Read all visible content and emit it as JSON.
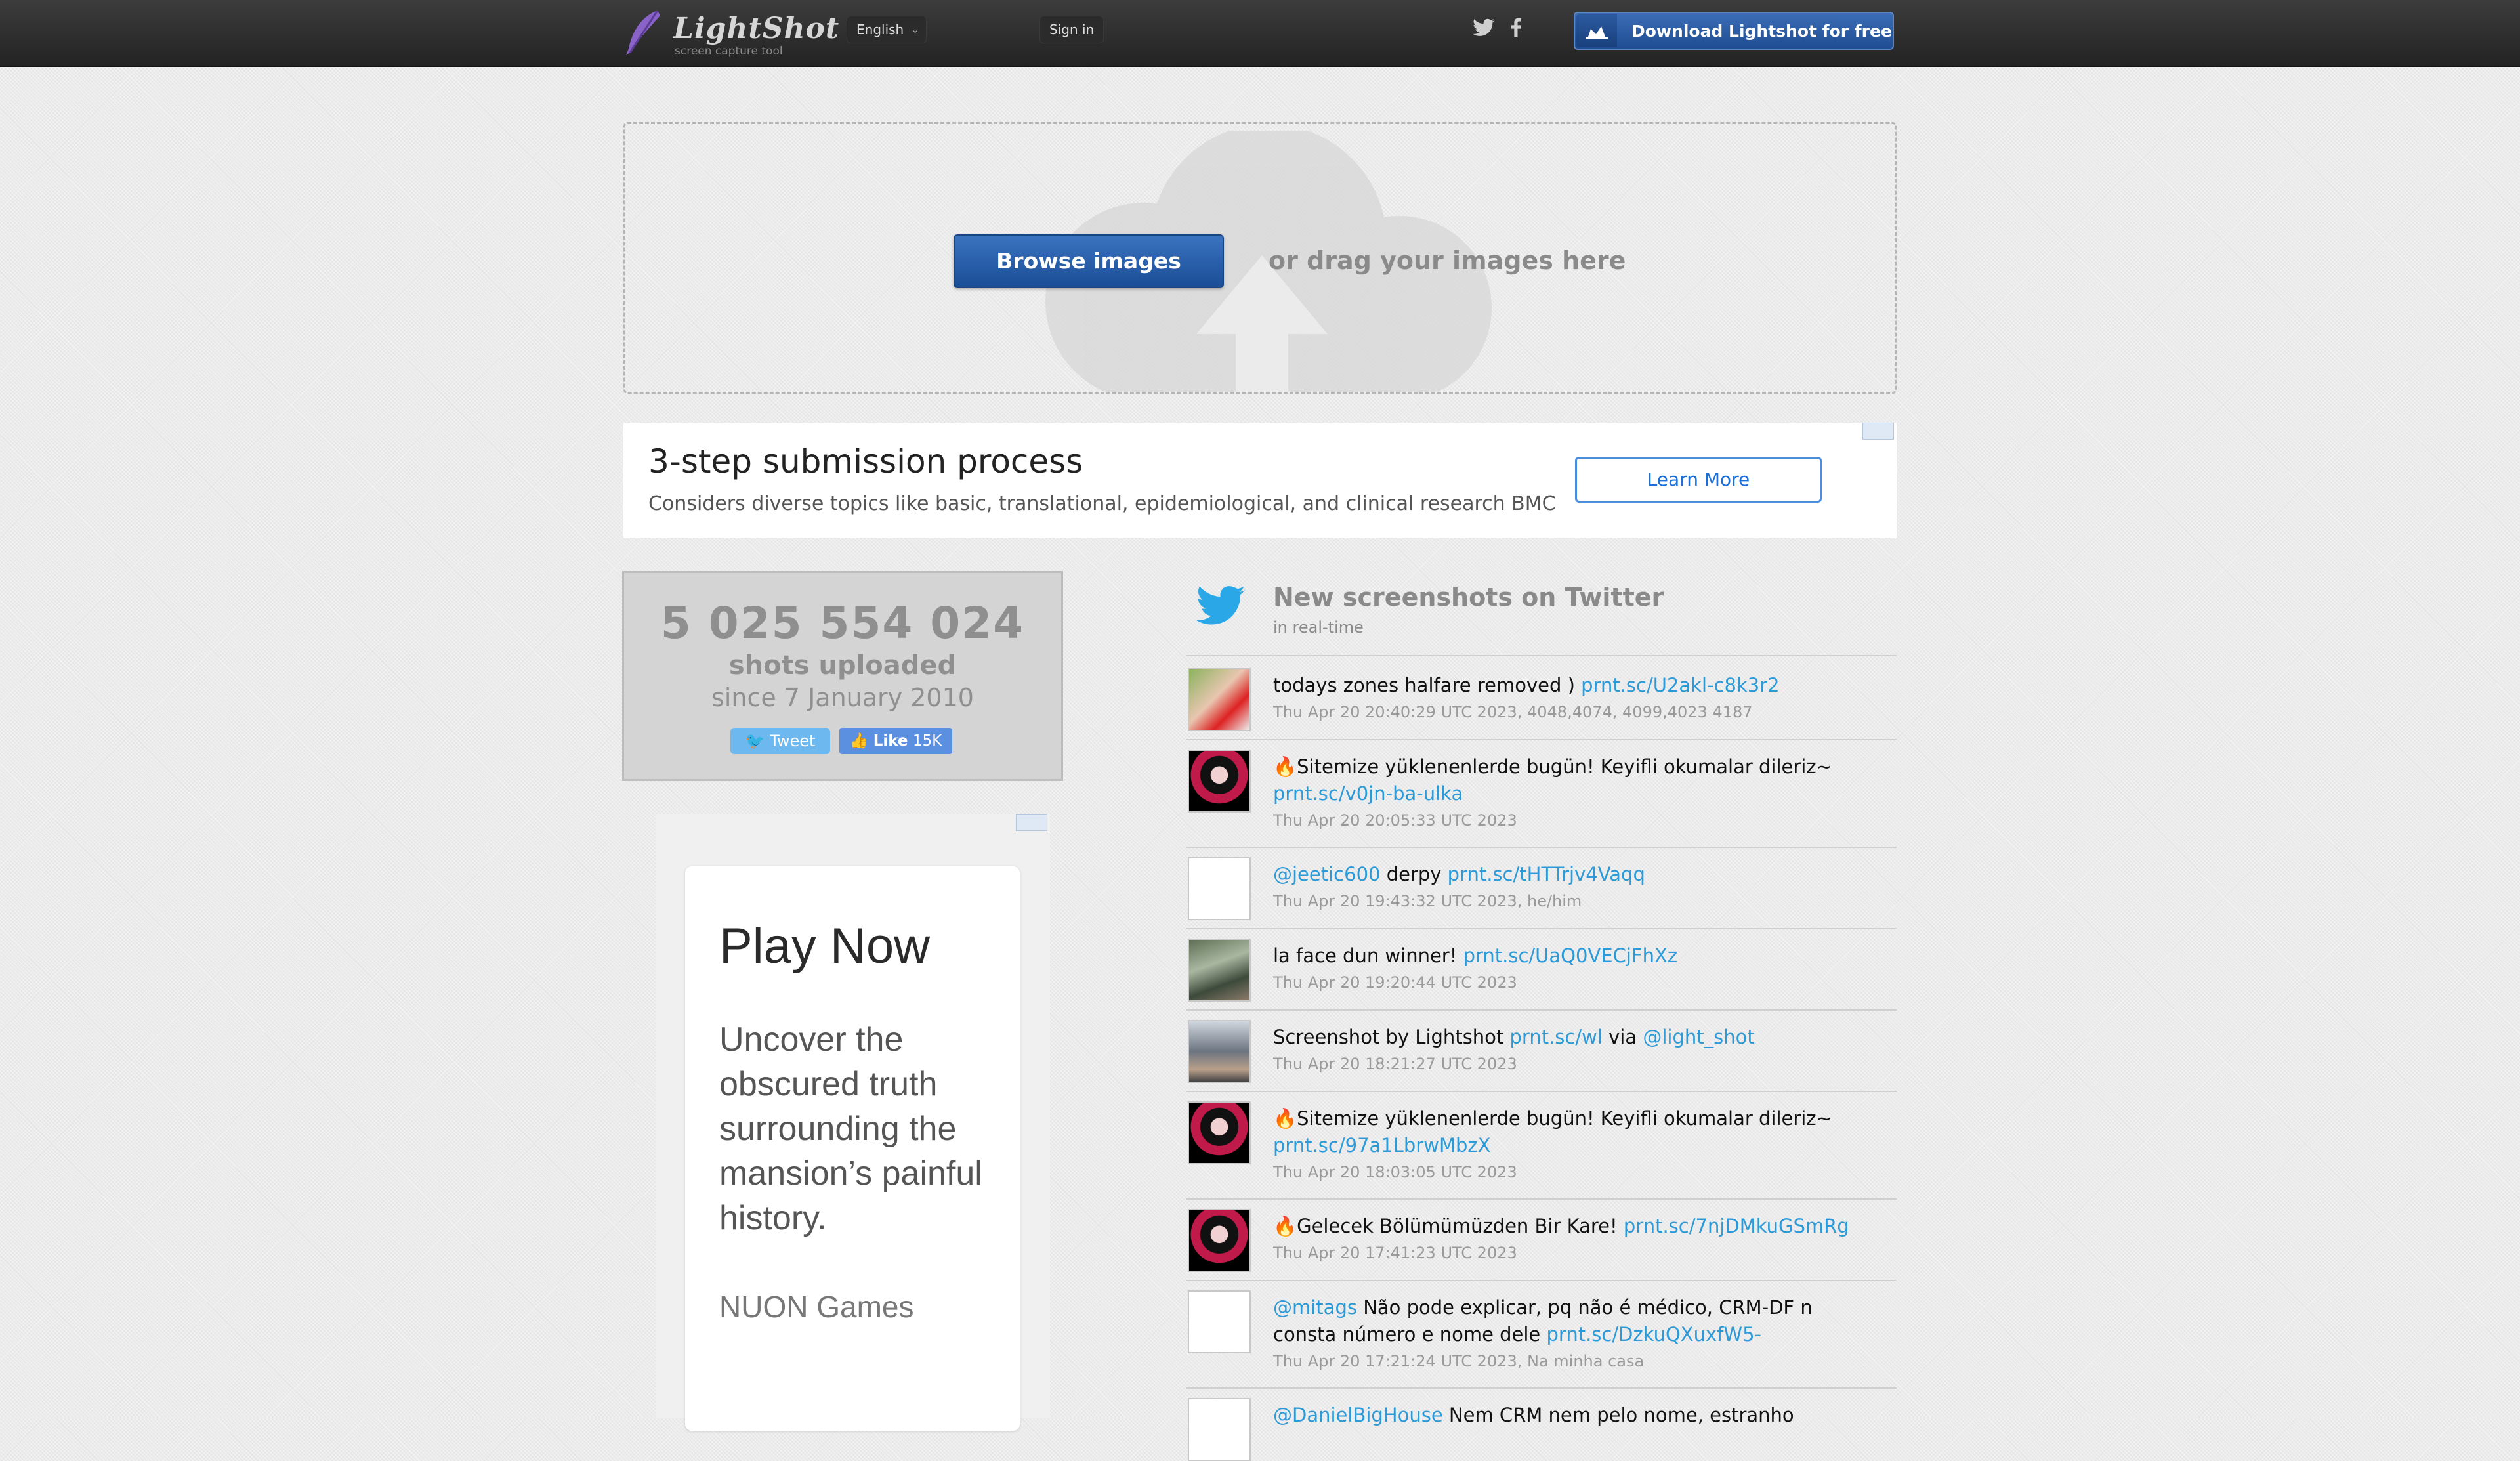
{
  "header": {
    "logo_text": "LightShot",
    "logo_sub": "screen capture tool",
    "language": "English",
    "signin": "Sign in",
    "download": "Download Lightshot for free"
  },
  "upload": {
    "browse": "Browse images",
    "drag": "or drag your images here"
  },
  "ad_banner": {
    "title": "3-step submission process",
    "description": "Considers diverse topics like basic, translational, epidemiological, and clinical research BMC",
    "cta": "Learn More"
  },
  "stats": {
    "count": "5 025 554 024",
    "label": "shots uploaded",
    "since": "since 7 January 2010",
    "tweet": "Tweet",
    "like": "Like",
    "like_count": "15K"
  },
  "side_ad": {
    "title": "Play Now",
    "text": "Uncover the obscured truth surrounding the mansion’s painful history.",
    "brand": "NUON Games"
  },
  "feed": {
    "title": "New screenshots on Twitter",
    "subtitle": "in real-time",
    "tweets": [
      {
        "pre": "",
        "text": "todays zones halfare removed )",
        "link": "prnt.sc/U2akl-c8k3r2",
        "mid": "",
        "link2": "",
        "meta": "Thu Apr 20 20:40:29 UTC 2023, 4048,4074, 4099,4023 4187"
      },
      {
        "pre": "",
        "text": "🔥Sitemize yüklenenlerde bugün! Keyifli okumalar dileriz~",
        "link": "prnt.sc/v0jn-ba-ulka",
        "mid": "",
        "link2": "",
        "meta": "Thu Apr 20 20:05:33 UTC 2023"
      },
      {
        "pre": "@jeetic600",
        "text": "derpy",
        "link": "prnt.sc/tHTTrjv4Vaqq",
        "mid": "",
        "link2": "",
        "meta": "Thu Apr 20 19:43:32 UTC 2023, he/him"
      },
      {
        "pre": "",
        "text": "la face dun winner!",
        "link": "prnt.sc/UaQ0VECjFhXz",
        "mid": "",
        "link2": "",
        "meta": "Thu Apr 20 19:20:44 UTC 2023"
      },
      {
        "pre": "",
        "text": "Screenshot by Lightshot",
        "link": "prnt.sc/wl",
        "mid": "via",
        "link2": "@light_shot",
        "meta": "Thu Apr 20 18:21:27 UTC 2023"
      },
      {
        "pre": "",
        "text": "🔥Sitemize yüklenenlerde bugün! Keyifli okumalar dileriz~",
        "link": "prnt.sc/97a1LbrwMbzX",
        "mid": "",
        "link2": "",
        "meta": "Thu Apr 20 18:03:05 UTC 2023"
      },
      {
        "pre": "",
        "text": "🔥Gelecek Bölümümüzden Bir Kare!",
        "link": "prnt.sc/7njDMkuGSmRg",
        "mid": "",
        "link2": "",
        "meta": "Thu Apr 20 17:41:23 UTC 2023"
      },
      {
        "pre": "@mitags",
        "text": "Não pode explicar, pq não é médico, CRM-DF n consta número e nome dele",
        "link": "prnt.sc/DzkuQXuxfW5-",
        "mid": "",
        "link2": "",
        "meta": "Thu Apr 20 17:21:24 UTC 2023, Na minha casa"
      },
      {
        "pre": "@DanielBigHouse",
        "text": "Nem CRM nem pelo nome, estranho",
        "link": "",
        "mid": "",
        "link2": "",
        "meta": ""
      }
    ]
  },
  "colors": {
    "brand_blue": "#1f4d92",
    "link": "#2d9ad8",
    "twitter": "#1da1f2"
  }
}
